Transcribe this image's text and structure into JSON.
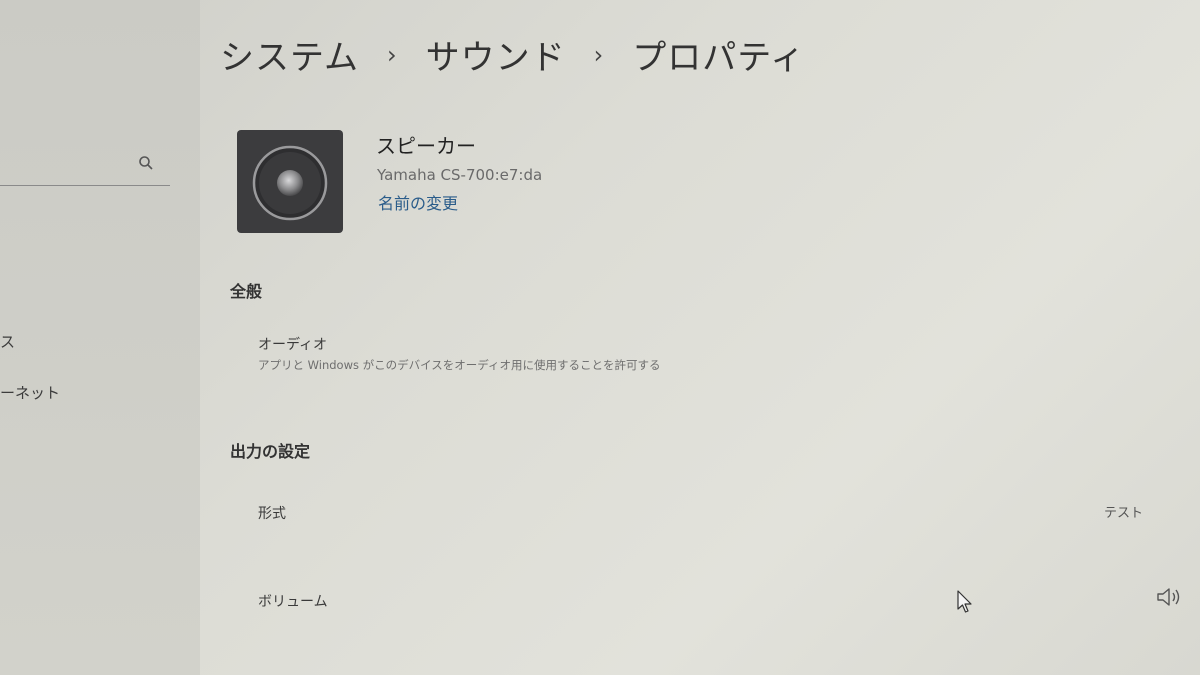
{
  "breadcrumb": {
    "items": [
      "システム",
      "サウンド",
      "プロパティ"
    ],
    "separator": "›"
  },
  "sidebar": {
    "items": [
      {
        "label": "ス"
      },
      {
        "label": "ーネット"
      }
    ]
  },
  "device": {
    "name": "スピーカー",
    "model": "Yamaha CS-700:e7:da",
    "rename_label": "名前の変更",
    "icon": "speaker-icon"
  },
  "general": {
    "heading": "全般",
    "audio_title": "オーディオ",
    "audio_desc": "アプリと Windows がこのデバイスをオーディオ用に使用することを許可する"
  },
  "output": {
    "heading": "出力の設定",
    "format_label": "形式",
    "format_value": "テスト",
    "volume_label": "ボリューム"
  },
  "colors": {
    "link": "#2a5c8a",
    "background": "#dcdcd5"
  }
}
